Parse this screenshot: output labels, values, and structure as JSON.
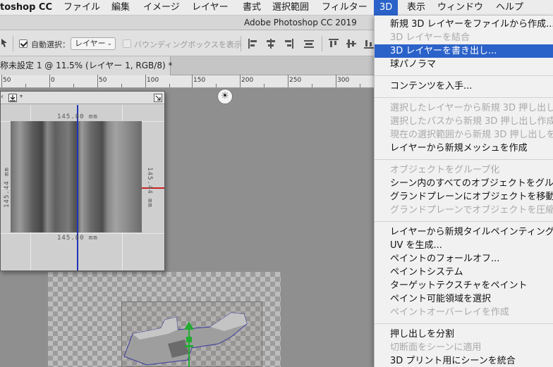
{
  "menubar": {
    "app": "toshop CC",
    "items": [
      "ファイル",
      "編集",
      "イメージ",
      "レイヤー",
      "書式",
      "選択範囲",
      "フィルター",
      "3D",
      "表示",
      "ウィンドウ",
      "ヘルプ"
    ],
    "active_index": 7
  },
  "window": {
    "title": "Adobe Photoshop CC 2019"
  },
  "options": {
    "auto_select_label": "自動選択：",
    "auto_select_checked": true,
    "target_select_value": "レイヤー",
    "show_bbox_label": "バウンディングボックスを表示",
    "show_bbox_checked": false
  },
  "document": {
    "tab_title": "称未設定 1 @ 11.5% (レイヤー 1, RGB/8) *"
  },
  "ruler": {
    "labels": [
      "50",
      "0",
      "50",
      "100",
      "150",
      "200",
      "250",
      "300"
    ]
  },
  "texture_panel": {
    "width_label_top": "145.80 mm",
    "width_label_bottom": "145.80 mm",
    "height_label_left": "145.44 mm",
    "height_label_right": "145.44 mm"
  },
  "menu_3d": {
    "items": [
      {
        "label": "新規 3D レイヤーをファイルから作成...",
        "disabled": false
      },
      {
        "label": "3D レイヤーを結合",
        "disabled": true
      },
      {
        "label": "3D レイヤーを書き出し...",
        "disabled": false,
        "highlighted": true
      },
      {
        "label": "球パノラマ",
        "disabled": false
      },
      {
        "label": "コンテンツを入手...",
        "disabled": false
      },
      {
        "label": "選択したレイヤーから新規 3D 押し出し",
        "disabled": true
      },
      {
        "label": "選択したパスから新規 3D 押し出し作成",
        "disabled": true
      },
      {
        "label": "現在の選択範囲から新規 3D 押し出しを",
        "disabled": true
      },
      {
        "label": "レイヤーから新規メッシュを作成",
        "disabled": false
      },
      {
        "label": "オブジェクトをグループ化",
        "disabled": true
      },
      {
        "label": "シーン内のすべてのオブジェクトをグル",
        "disabled": false
      },
      {
        "label": "グランドプレーンにオブジェクトを移動",
        "disabled": false
      },
      {
        "label": "グランドプレーンでオブジェクトを圧縮",
        "disabled": true
      },
      {
        "label": "レイヤーから新規タイルペインティング",
        "disabled": false
      },
      {
        "label": "UV を生成...",
        "disabled": false
      },
      {
        "label": "ペイントのフォールオフ...",
        "disabled": false
      },
      {
        "label": "ペイントシステム",
        "disabled": false
      },
      {
        "label": "ターゲットテクスチャをペイント",
        "disabled": false
      },
      {
        "label": "ペイント可能領域を選択",
        "disabled": false
      },
      {
        "label": "ペイントオーバーレイを作成",
        "disabled": true
      },
      {
        "label": "押し出しを分割",
        "disabled": false
      },
      {
        "label": "切断面をシーンに適用",
        "disabled": true
      },
      {
        "label": "3D プリント用にシーンを統合",
        "disabled": false
      }
    ]
  },
  "colors": {
    "menu_highlight": "#2b62c9",
    "axis_red": "#cc2222",
    "axis_blue": "#2233bb",
    "gizmo_green": "#22aa33"
  }
}
